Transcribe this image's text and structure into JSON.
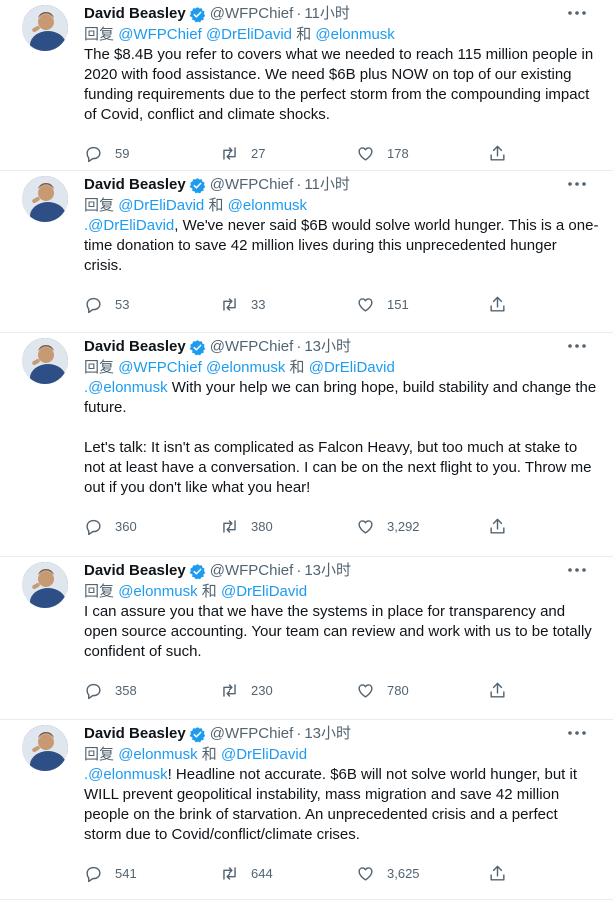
{
  "tweets": [
    {
      "name": "David Beasley",
      "handle": "@WFPChief",
      "dot": "·",
      "time": "11小时",
      "reply_prefix": "回复",
      "reply_mentions": [
        "@WFPChief",
        "@DrEliDavid"
      ],
      "reply_and": "和",
      "reply_last": "@elonmusk",
      "text_lead_mention": "",
      "text": "The $8.4B you refer to covers what we needed to reach 115 million people in 2020 with food assistance. We need $6B plus NOW on top of our existing funding requirements due to the perfect storm from the compounding impact of Covid, conflict and climate shocks.",
      "replies": "59",
      "retweets": "27",
      "likes": "178"
    },
    {
      "name": "David Beasley",
      "handle": "@WFPChief",
      "dot": "·",
      "time": "11小时",
      "reply_prefix": "回复",
      "reply_mentions": [
        "@DrEliDavid"
      ],
      "reply_and": "和",
      "reply_last": "@elonmusk",
      "text_lead_mention": ".@DrEliDavid",
      "text": ", We've never said $6B would solve world hunger. This is a one-time donation to save 42 million lives during this unprecedented hunger crisis.",
      "replies": "53",
      "retweets": "33",
      "likes": "151"
    },
    {
      "name": "David Beasley",
      "handle": "@WFPChief",
      "dot": "·",
      "time": "13小时",
      "reply_prefix": "回复",
      "reply_mentions": [
        "@WFPChief",
        "@elonmusk"
      ],
      "reply_and": "和",
      "reply_last": "@DrEliDavid",
      "text_lead_mention": ".@elonmusk",
      "text": " With your help we can bring hope, build stability and change the future.\n\nLet's talk: It isn't as complicated as Falcon Heavy, but too much at stake to not at least have a conversation. I can be on the next flight to you. Throw me out if you don't like what you hear!",
      "replies": "360",
      "retweets": "380",
      "likes": "3,292"
    },
    {
      "name": "David Beasley",
      "handle": "@WFPChief",
      "dot": "·",
      "time": "13小时",
      "reply_prefix": "回复",
      "reply_mentions": [
        "@elonmusk"
      ],
      "reply_and": "和",
      "reply_last": "@DrEliDavid",
      "text_lead_mention": "",
      "text": "I can assure you that we have the systems in place for transparency and open source accounting. Your team can review and work with us to be totally confident of such.",
      "replies": "358",
      "retweets": "230",
      "likes": "780"
    },
    {
      "name": "David Beasley",
      "handle": "@WFPChief",
      "dot": "·",
      "time": "13小时",
      "reply_prefix": "回复",
      "reply_mentions": [
        "@elonmusk"
      ],
      "reply_and": "和",
      "reply_last": "@DrEliDavid",
      "text_lead_mention": ".@elonmusk",
      "text": "! Headline not accurate. $6B will not solve world hunger, but it WILL prevent geopolitical instability, mass migration and save 42 million people on the brink of starvation. An unprecedented crisis and a perfect storm due to Covid/conflict/climate crises.",
      "replies": "541",
      "retweets": "644",
      "likes": "3,625"
    }
  ],
  "colors": {
    "accent": "#1d9bf0",
    "muted": "#536471",
    "text": "#0f1419",
    "divider": "#e6ecf0"
  },
  "icons": {
    "reply": "reply-icon",
    "retweet": "retweet-icon",
    "like": "like-icon",
    "share": "share-icon",
    "more": "more-icon",
    "verified": "verified-badge-icon"
  }
}
